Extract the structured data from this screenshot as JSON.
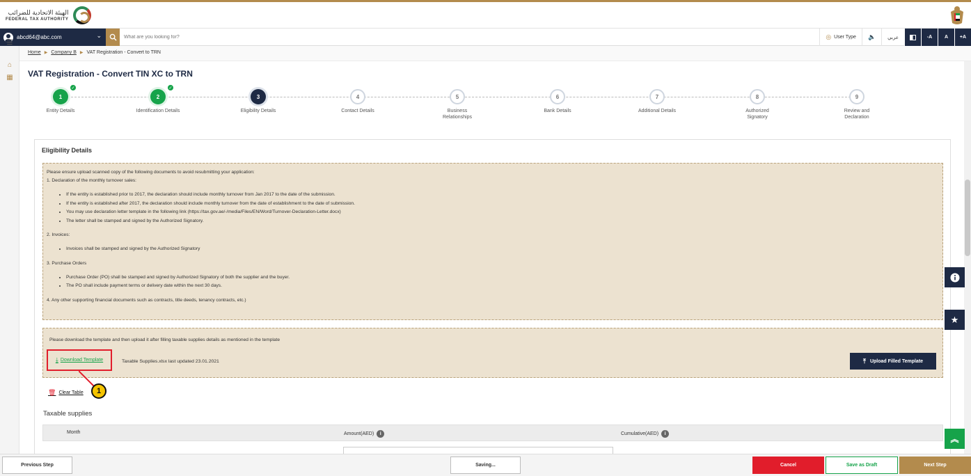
{
  "header": {
    "logo_ar": "الهيئة الاتحادية للضرائب",
    "logo_en": "FEDERAL TAX AUTHORITY"
  },
  "navbar": {
    "user_email": "abcd64@abc.com",
    "search_placeholder": "What are you looking for?",
    "user_type": "User Type",
    "lang": "عربي",
    "font_decrease": "-A",
    "font_normal": "A",
    "font_increase": "+A"
  },
  "breadcrumb": {
    "home": "Home",
    "company": "Company B",
    "current": "VAT Registration - Convert to TRN"
  },
  "page": {
    "title": "VAT Registration - Convert TIN XC to TRN"
  },
  "steps": [
    {
      "num": "1",
      "label": "Entity Details",
      "state": "done"
    },
    {
      "num": "2",
      "label": "Identification Details",
      "state": "done"
    },
    {
      "num": "3",
      "label": "Eligibility Details",
      "state": "current"
    },
    {
      "num": "4",
      "label": "Contact Details",
      "state": "todo"
    },
    {
      "num": "5",
      "label": "Business Relationships",
      "state": "todo"
    },
    {
      "num": "6",
      "label": "Bank Details",
      "state": "todo"
    },
    {
      "num": "7",
      "label": "Additional Details",
      "state": "todo"
    },
    {
      "num": "8",
      "label": "Authorized Signatory",
      "state": "todo"
    },
    {
      "num": "9",
      "label": "Review and Declaration",
      "state": "todo"
    }
  ],
  "eligibility": {
    "section_title": "Eligibility Details",
    "intro": "Please ensure upload scanned copy of the following documents to avoid resubmitting your application:",
    "item1": "1. Declaration of the monthly turnover sales:",
    "item1_bullets": [
      "If the entity is established prior to 2017, the declaration should include monthly turnover from Jan 2017 to the date of the submission.",
      "If the entity is established after 2017, the declaration should include monthly turnover from the date of establishment to the date of submission.",
      "You may use declaration letter template in the following link (https://tax.gov.ae/-/media/Files/EN/Word/Turnover-Declaration-Letter.docx)",
      "The letter shall be stamped and signed by the Authorized Signatory."
    ],
    "item2": "2. Invoices:",
    "item2_bullets": [
      "Invoices shall be stamped and signed by the Authorized Signatory"
    ],
    "item3": "3. Purchase Orders",
    "item3_bullets": [
      "Purchase Order (PO) shall be stamped and signed by Authorized Signatory of both the supplier and the buyer.",
      "The PO shall include payment terms or delivery date within the next 30 days."
    ],
    "item4": "4. Any other supporting financial documents such as contracts, title deeds, tenancy contracts, etc.)"
  },
  "template": {
    "note": "Please download the template and then upload it after filling taxable supplies details as mentioned in the template",
    "download_label": "Download Template",
    "file_info": "Taxable Supplies.xlsx last updated 23.01.2021",
    "upload_label": "Upload Filled Template"
  },
  "callout": {
    "number": "1"
  },
  "table": {
    "clear_label": "Clear Table",
    "title": "Taxable supplies",
    "columns": [
      "Month",
      "Amount(AED)",
      "Cumulative(AED)"
    ]
  },
  "footer": {
    "previous": "Previous Step",
    "saving": "Saving...",
    "cancel": "Cancel",
    "draft": "Save as Draft",
    "next": "Next Step"
  },
  "colors": {
    "navy": "#1e2a44",
    "gold": "#b38b4d",
    "green": "#16a34a",
    "red": "#e11d2b",
    "beige": "#ece2d0"
  }
}
